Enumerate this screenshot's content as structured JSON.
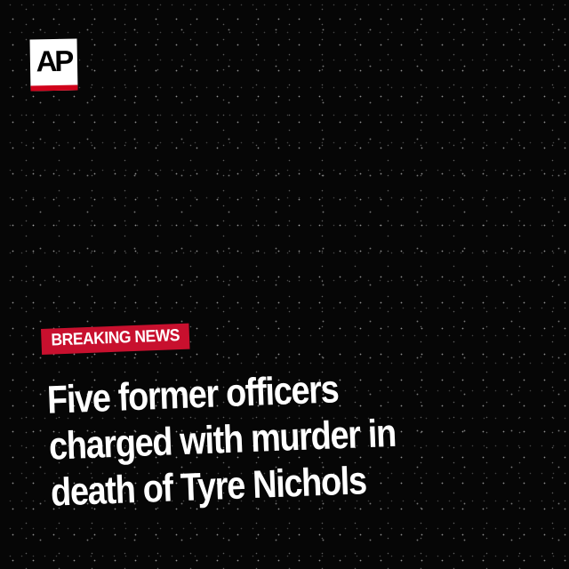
{
  "logo": {
    "text": "AP",
    "bar_color": "#d0021b"
  },
  "badge": {
    "label": "BREAKING NEWS",
    "color": "#c8102e"
  },
  "headline": {
    "lines": [
      "Five former officers",
      "charged with murder in",
      "death of Tyre Nichols"
    ]
  }
}
